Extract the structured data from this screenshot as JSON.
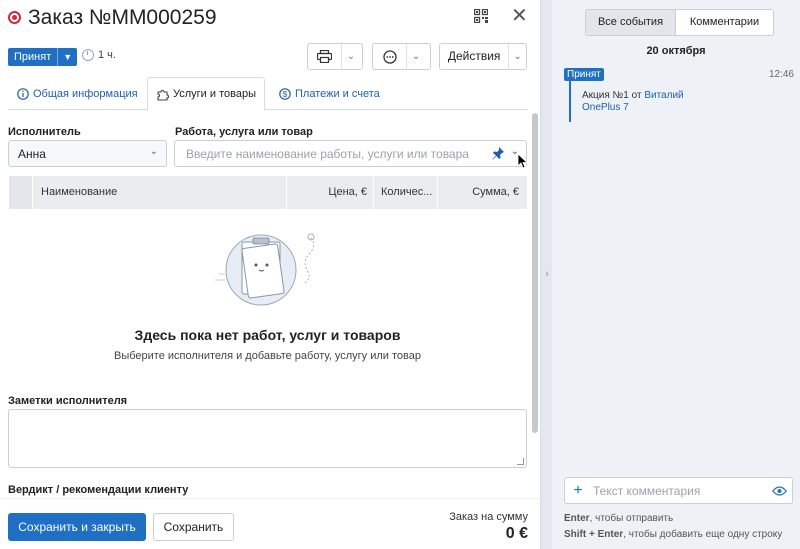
{
  "header": {
    "title": "Заказ №ММ000259"
  },
  "status": {
    "label": "Принят",
    "time": "1 ч."
  },
  "actions": {
    "label": "Действия"
  },
  "tabs": [
    {
      "label": "Общая информация",
      "icon": "info-icon"
    },
    {
      "label": "Услуги и товары",
      "icon": "puzzle-icon"
    },
    {
      "label": "Платежи и счета",
      "icon": "dollar-icon"
    }
  ],
  "fields": {
    "executor_label": "Исполнитель",
    "executor_value": "Анна",
    "work_label": "Работа, услуга или товар",
    "work_placeholder": "Введите наименование работы, услуги или товара"
  },
  "table": {
    "columns": [
      "Наименование",
      "Цена, €",
      "Количес...",
      "Сумма, €"
    ]
  },
  "empty": {
    "title": "Здесь пока нет работ, услуг и товаров",
    "subtitle": "Выберите исполнителя и добавьте работу, услугу или товар"
  },
  "notes": {
    "label": "Заметки исполнителя",
    "verdict_label": "Вердикт / рекомендации клиенту"
  },
  "footer": {
    "save_close": "Сохранить и закрыть",
    "save": "Сохранить",
    "sum_label": "Заказ на сумму",
    "sum_value": "0 €"
  },
  "panel": {
    "tab_all": "Все события",
    "tab_comments": "Комментарии",
    "date": "20 октября",
    "event": {
      "badge": "Принят",
      "time": "12:46",
      "text": "Акция №1 от ",
      "author": "Виталий",
      "item": "OnePlus 7"
    },
    "comment_placeholder": "Текст комментария",
    "hint1_key": "Enter",
    "hint1_text": ", чтобы отправить",
    "hint2_key": "Shift + Enter",
    "hint2_text": ", чтобы добавить еще одну строку"
  },
  "colors": {
    "accent": "#1f6fc5",
    "status_red": "#d7263d",
    "panel_bg": "#eef2f6"
  }
}
